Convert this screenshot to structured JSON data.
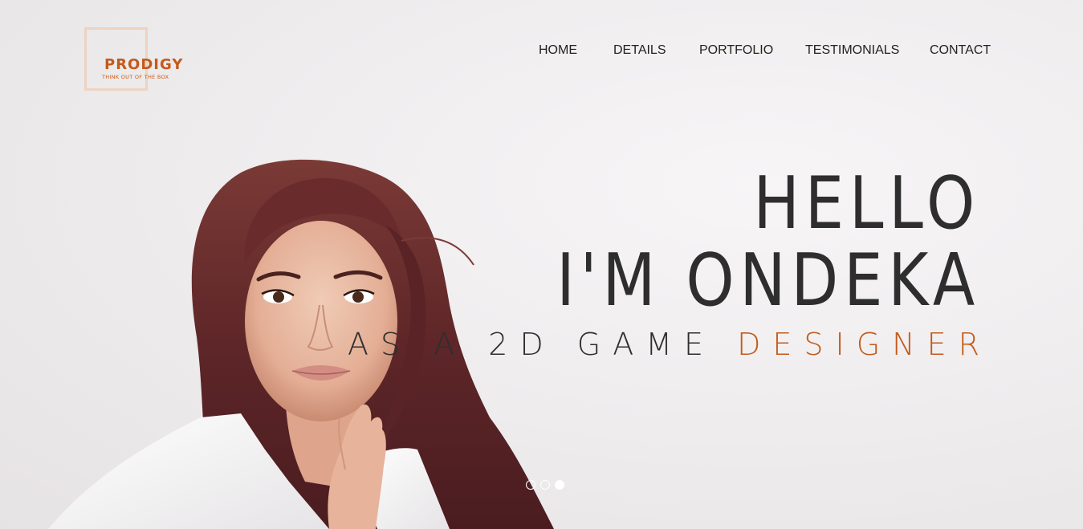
{
  "logo": {
    "name": "PRODIGY",
    "tagline": "THINK OUT OF THE BOX"
  },
  "nav": {
    "items": [
      {
        "label": "HOME"
      },
      {
        "label": "DETAILS"
      },
      {
        "label": "PORTFOLIO"
      },
      {
        "label": "TESTIMONIALS"
      },
      {
        "label": "CONTACT"
      }
    ]
  },
  "hero": {
    "line1": "HELLO",
    "line2": "I'M ONDEKA",
    "line3_prefix": "AS A 2D GAME ",
    "line3_accent": "DESIGNER"
  },
  "slider": {
    "count": 3,
    "active_index": 2
  },
  "colors": {
    "accent": "#c35a1b",
    "logo_box": "#edd3c2",
    "headline": "#2e2e2e",
    "background": "#efedee"
  }
}
